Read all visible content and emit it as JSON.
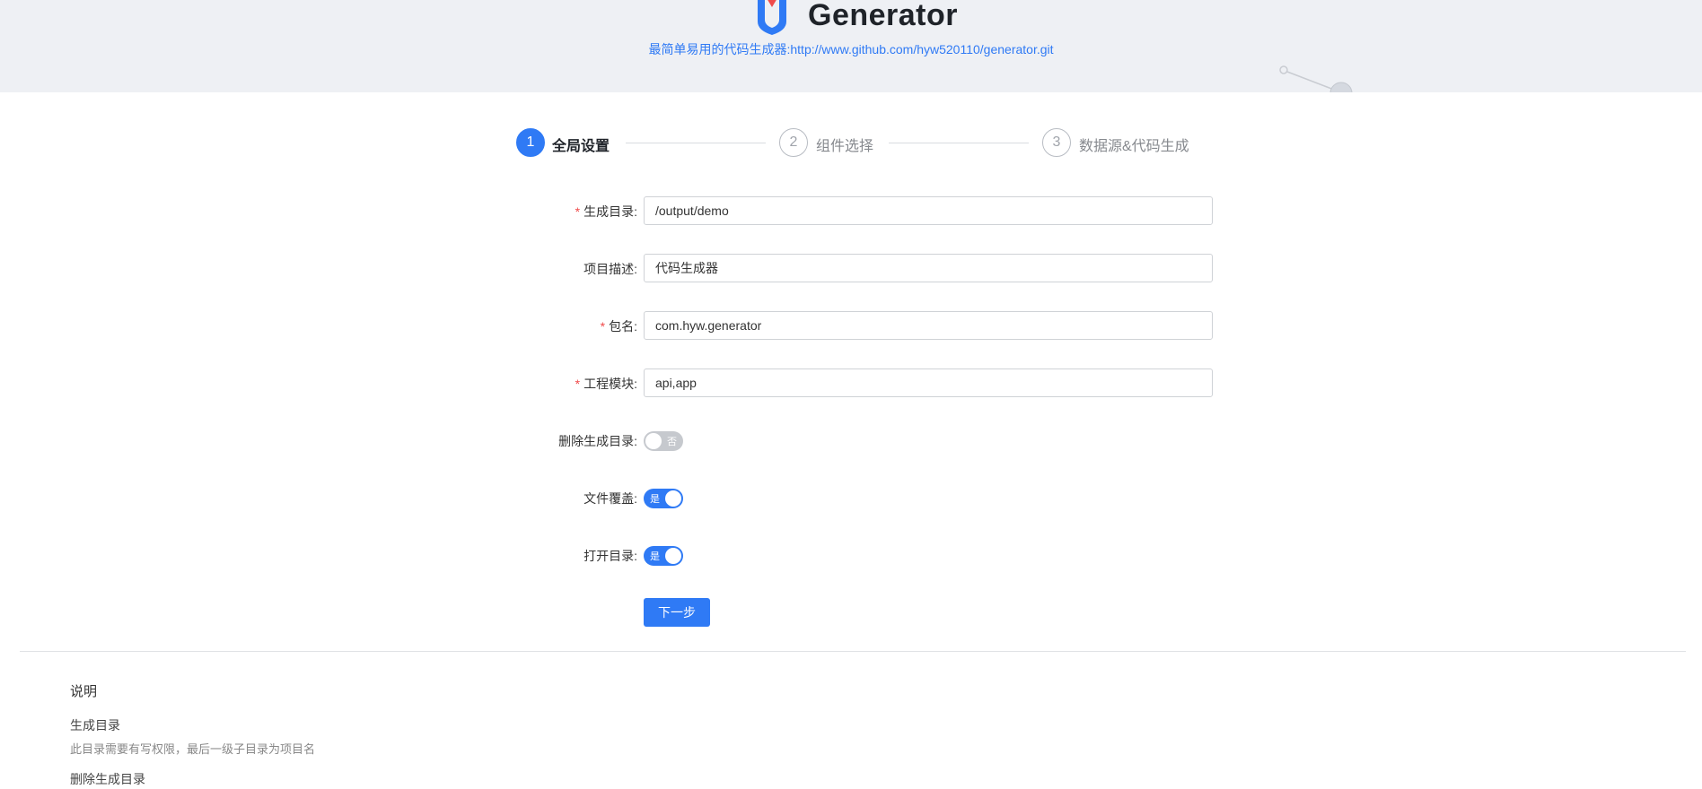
{
  "header": {
    "title": "Generator",
    "subtitle": "最简单易用的代码生成器:http://www.github.com/hyw520110/generator.git"
  },
  "steps": [
    {
      "number": "1",
      "label": "全局设置",
      "active": true
    },
    {
      "number": "2",
      "label": "组件选择",
      "active": false
    },
    {
      "number": "3",
      "label": "数据源&代码生成",
      "active": false
    }
  ],
  "form": {
    "output_dir": {
      "label": "生成目录:",
      "required": "*",
      "value": "/output/demo"
    },
    "description": {
      "label": "项目描述:",
      "value": "代码生成器"
    },
    "package": {
      "label": "包名:",
      "required": "*",
      "value": "com.hyw.generator"
    },
    "modules": {
      "label": "工程模块:",
      "required": "*",
      "value": "api,app"
    },
    "delete_dir": {
      "label": "删除生成目录:",
      "state": "否"
    },
    "overwrite": {
      "label": "文件覆盖:",
      "state": "是"
    },
    "open_dir": {
      "label": "打开目录:",
      "state": "是"
    },
    "next_label": "下一步"
  },
  "notes": {
    "title": "说明",
    "items": [
      {
        "heading": "生成目录",
        "text": "此目录需要有写权限，最后一级子目录为项目名"
      },
      {
        "heading": "删除生成目录"
      }
    ]
  },
  "colors": {
    "accent": "#2f7af5",
    "required": "#f04b4b",
    "header_bg": "#eef0f4"
  }
}
